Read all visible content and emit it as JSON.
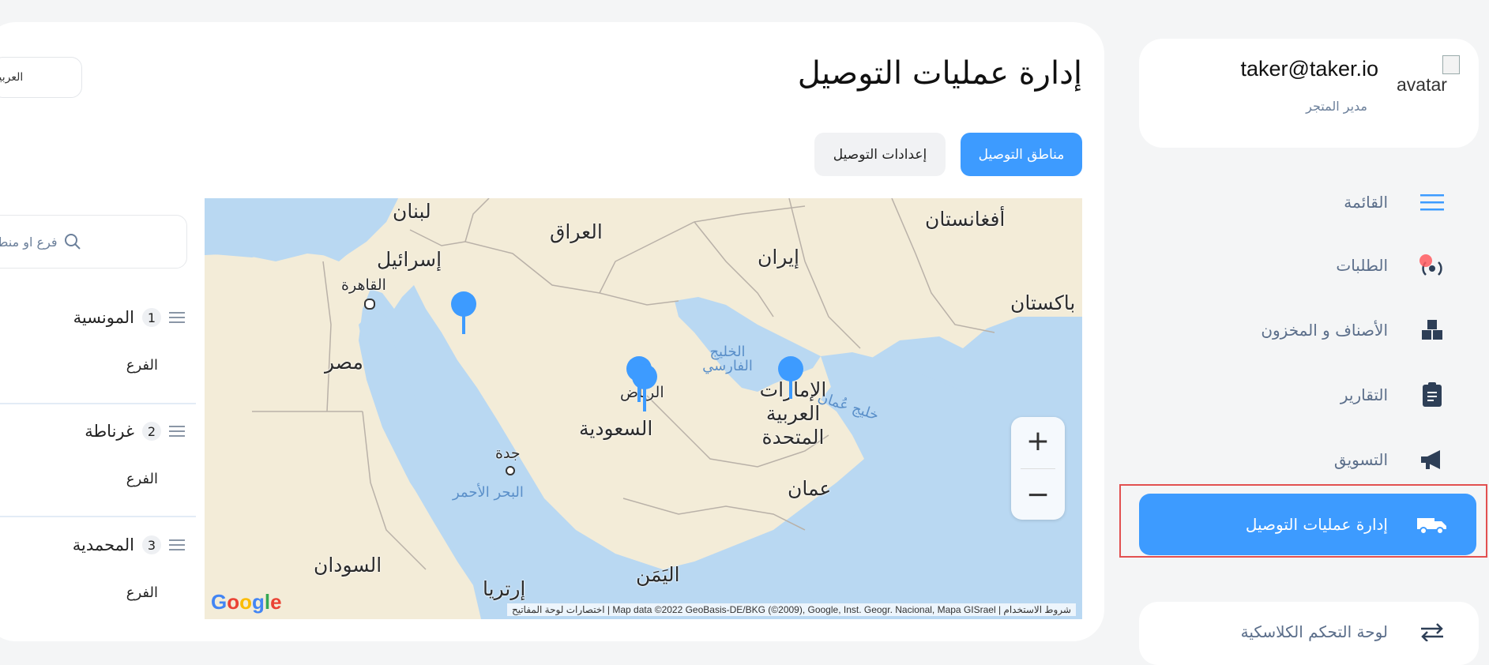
{
  "language": "العربية",
  "page": {
    "title": "إدارة عمليات التوصيل",
    "tabs": [
      {
        "label": "مناطق التوصيل",
        "active": true
      },
      {
        "label": "إعدادات التوصيل",
        "active": false
      }
    ]
  },
  "map": {
    "labels": {
      "lebanon": "لبنان",
      "iraq": "العراق",
      "afghanistan": "أفغانستان",
      "israel": "إسرائيل",
      "cairo": "القاهرة",
      "iran": "إيران",
      "pakistan": "باكستان",
      "egypt": "مصر",
      "persian_gulf": "الخليج الفارسي",
      "riyadh": "الرياض",
      "uae": "الإمارات العربية المتحدة",
      "saudi": "السعودية",
      "gulf_of_oman": "خليج عُمان",
      "jeddah": "جدة",
      "red_sea": "البحر الأحمر",
      "oman": "عمان",
      "sudan": "السودان",
      "yemen": "اليَمَن",
      "eritrea": "إرتريا"
    },
    "google": "Google",
    "attribution": "اختصارات لوحة المفاتيح | Map data ©2022 GeoBasis-DE/BKG (©2009), Google, Inst. Geogr. Nacional, Mapa GISrael | شروط الاستخدام",
    "zoom_in": "+",
    "zoom_out": "−"
  },
  "branches": {
    "search_placeholder": "فرع او منطقة",
    "items": [
      {
        "number": "1",
        "name": "المونسية",
        "type": "الفرع"
      },
      {
        "number": "2",
        "name": "غرناطة",
        "type": "الفرع"
      },
      {
        "number": "3",
        "name": "المحمدية",
        "type": "الفرع"
      }
    ]
  },
  "profile": {
    "email": "taker@taker.io",
    "role": "مدير المتجر",
    "avatar_alt": "avatar"
  },
  "nav": {
    "menu": "القائمة",
    "orders": "الطلبات",
    "items_inventory": "الأصناف و المخزون",
    "reports": "التقارير",
    "marketing": "التسويق",
    "delivery": "إدارة عمليات التوصيل",
    "classic_dashboard": "لوحة التحكم الكلاسكية"
  },
  "colors": {
    "accent": "#3d9bff",
    "nav_text": "#5b6e8a",
    "highlight_outline": "#e25050"
  }
}
